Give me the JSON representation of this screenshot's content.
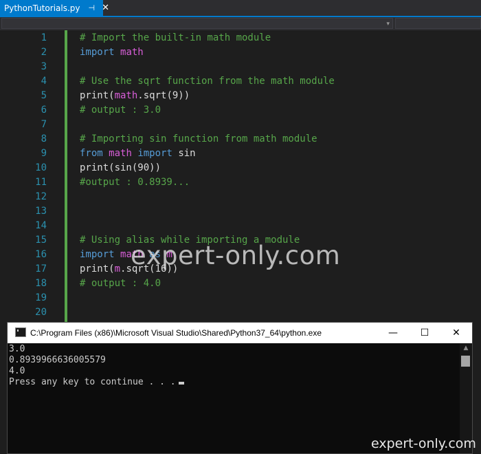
{
  "tab": {
    "filename": "PythonTutorials.py",
    "pin_glyph": "⊣",
    "close_glyph": "✕"
  },
  "navbar": {
    "dropdown_arrow": "▾"
  },
  "editor": {
    "lines": [
      {
        "num": "1",
        "tokens": [
          {
            "text": "# Import the built-in math module",
            "kind": "comment"
          }
        ]
      },
      {
        "num": "2",
        "tokens": [
          {
            "text": "import",
            "kind": "keyword"
          },
          {
            "text": " ",
            "kind": "default"
          },
          {
            "text": "math",
            "kind": "module"
          }
        ]
      },
      {
        "num": "3",
        "tokens": []
      },
      {
        "num": "4",
        "tokens": [
          {
            "text": "# Use the sqrt function from the math module",
            "kind": "comment"
          }
        ]
      },
      {
        "num": "5",
        "tokens": [
          {
            "text": "print(",
            "kind": "default"
          },
          {
            "text": "math",
            "kind": "module"
          },
          {
            "text": ".sqrt(9))",
            "kind": "default"
          }
        ]
      },
      {
        "num": "6",
        "tokens": [
          {
            "text": "# output : 3.0",
            "kind": "comment"
          }
        ]
      },
      {
        "num": "7",
        "tokens": []
      },
      {
        "num": "8",
        "tokens": [
          {
            "text": "# Importing sin function from math module",
            "kind": "comment"
          }
        ]
      },
      {
        "num": "9",
        "tokens": [
          {
            "text": "from",
            "kind": "keyword"
          },
          {
            "text": " ",
            "kind": "default"
          },
          {
            "text": "math",
            "kind": "module"
          },
          {
            "text": " ",
            "kind": "default"
          },
          {
            "text": "import",
            "kind": "keyword"
          },
          {
            "text": " sin",
            "kind": "default"
          }
        ]
      },
      {
        "num": "10",
        "tokens": [
          {
            "text": "print(sin(90))",
            "kind": "default"
          }
        ]
      },
      {
        "num": "11",
        "tokens": [
          {
            "text": "#output : 0.8939...",
            "kind": "comment"
          }
        ]
      },
      {
        "num": "12",
        "tokens": []
      },
      {
        "num": "13",
        "tokens": []
      },
      {
        "num": "14",
        "tokens": []
      },
      {
        "num": "15",
        "tokens": [
          {
            "text": "# Using alias while importing a module",
            "kind": "comment"
          }
        ]
      },
      {
        "num": "16",
        "tokens": [
          {
            "text": "import",
            "kind": "keyword"
          },
          {
            "text": " ",
            "kind": "default"
          },
          {
            "text": "math",
            "kind": "module"
          },
          {
            "text": " ",
            "kind": "default"
          },
          {
            "text": "as",
            "kind": "keyword"
          },
          {
            "text": " ",
            "kind": "default"
          },
          {
            "text": "m",
            "kind": "module"
          }
        ]
      },
      {
        "num": "17",
        "tokens": [
          {
            "text": "print(",
            "kind": "default"
          },
          {
            "text": "m",
            "kind": "module"
          },
          {
            "text": ".sqrt(16))",
            "kind": "default"
          }
        ]
      },
      {
        "num": "18",
        "tokens": [
          {
            "text": "# output : 4.0",
            "kind": "comment"
          }
        ]
      },
      {
        "num": "19",
        "tokens": []
      },
      {
        "num": "20",
        "tokens": []
      }
    ],
    "colors": {
      "comment": "#57a64a",
      "keyword": "#569cd6",
      "module": "#d85ed8",
      "default": "#dcdcdc",
      "line_number": "#2b91af",
      "tab_accent": "#007acc"
    }
  },
  "watermark": "expert-only.com",
  "console": {
    "title": "C:\\Program Files (x86)\\Microsoft Visual Studio\\Shared\\Python37_64\\python.exe",
    "minimize_glyph": "—",
    "maximize_glyph": "☐",
    "close_glyph": "✕",
    "output_lines": [
      "3.0",
      "0.8939966636005579",
      "4.0",
      "Press any key to continue . . ."
    ],
    "scroll_up_glyph": "▲"
  },
  "brand": "expert-only.com"
}
